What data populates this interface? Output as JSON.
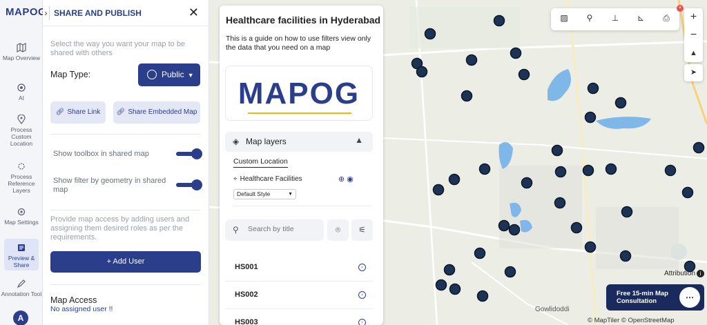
{
  "app": {
    "logo": "MAPOG"
  },
  "rail": {
    "items": [
      {
        "label": "Map Overview",
        "icon": "map-icon"
      },
      {
        "label": "AI",
        "icon": "ai-icon"
      },
      {
        "label": "Process Custom Location",
        "icon": "location-pin-icon"
      },
      {
        "label": "Process Reference Layers",
        "icon": "layers-gear-icon"
      },
      {
        "label": "Map Settings",
        "icon": "settings-icon"
      },
      {
        "label": "Preview & Share",
        "icon": "preview-share-icon"
      },
      {
        "label": "Annotation Tool",
        "icon": "annotation-icon"
      }
    ],
    "avatar": "A"
  },
  "panel": {
    "title": "SHARE AND PUBLISH",
    "intro": "Select the way you want your map to be shared with others",
    "map_type_label": "Map Type:",
    "map_type_value": "Public",
    "share_link": "Share Link",
    "share_embedded": "Share Embedded Map",
    "toggle_toolbox": "Show toolbox in shared map",
    "toggle_filter": "Show filter by geometry in shared map",
    "access_text": "Provide map access by adding users and assigning them desired roles as per the requirements.",
    "add_user": "+ Add User",
    "access_title": "Map Access",
    "access_none": "No assigned user !!"
  },
  "card": {
    "title": "Healthcare facilities in Hyderabad",
    "description": "This is a guide on how to use filters view only the data that you need on a map",
    "logo_text": "MAPOG",
    "layers_label": "Map layers",
    "custom_location_tab": "Custom Location",
    "layer_name": "Healthcare Facilities",
    "style_value": "Default Style",
    "search_placeholder": "Search by title",
    "facilities": [
      "HS001",
      "HS002",
      "HS003"
    ]
  },
  "map": {
    "attribution": "Attribution",
    "consult": "Free 15-min Map Consultation",
    "copyright": "© MapTiler © OpenStreetMap contributors",
    "place": "Gowlidoddi",
    "marker_color": "#1c3355",
    "water_color": "#7fb8e8",
    "land_color": "#eceee6"
  },
  "toolbar": {
    "badge": "×"
  }
}
